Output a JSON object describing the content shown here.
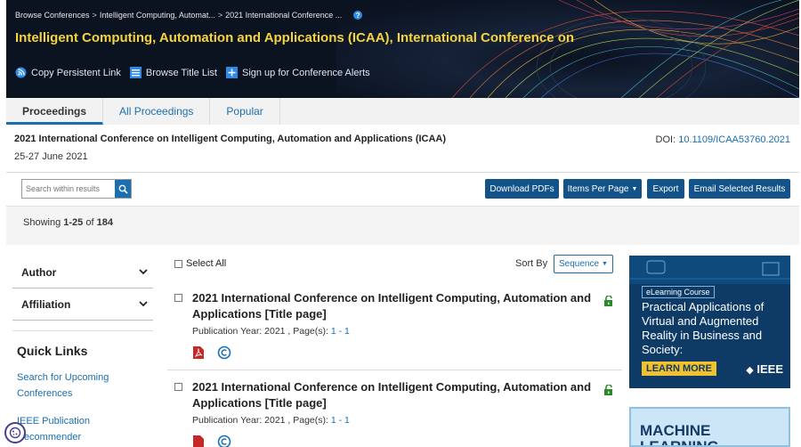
{
  "header": {
    "breadcrumbs": [
      "Browse Conferences",
      "Intelligent Computing, Automat...",
      "2021 International Conference ..."
    ],
    "help_icon": "?",
    "title": "Intelligent Computing, Automation and Applications (ICAA), International Conference on",
    "actions": [
      {
        "label": "Copy Persistent Link",
        "icon": "rss-icon"
      },
      {
        "label": "Browse Title List",
        "icon": "list-icon"
      },
      {
        "label": "Sign up for Conference Alerts",
        "icon": "plus-icon"
      }
    ]
  },
  "tabs": [
    "Proceedings",
    "All Proceedings",
    "Popular"
  ],
  "conference": {
    "name": "2021 International Conference on Intelligent Computing, Automation and Applications (ICAA)",
    "date": "25-27 June 2021",
    "doi_label": "DOI:",
    "doi_value": "10.1109/ICAA53760.2021"
  },
  "toolbar": {
    "search_placeholder": "Search within results",
    "buttons": [
      "Download PDFs",
      "Items Per Page",
      "Export",
      "Email Selected Results"
    ]
  },
  "showing": {
    "prefix": "Showing",
    "range": "1-25",
    "of": "of",
    "total": "184"
  },
  "sidebar": {
    "facets": [
      "Author",
      "Affiliation"
    ],
    "quick_links_title": "Quick Links",
    "links": [
      "Search for Upcoming Conferences",
      "IEEE Publication Recommender"
    ]
  },
  "results_header": {
    "select_all": "Select All",
    "sort_label": "Sort By",
    "sort_value": "Sequence"
  },
  "results": [
    {
      "title": "2021 International Conference on Intelligent Computing, Automation and Applications [Title page]",
      "meta_prefix": "Publication Year: 2021 , Page(s):",
      "pages": "1 - 1"
    },
    {
      "title": "2021 International Conference on Intelligent Computing, Automation and Applications [Title page]",
      "meta_prefix": "Publication Year: 2021 , Page(s):",
      "pages": "1 - 1"
    }
  ],
  "ads": {
    "ad1": {
      "badge": "eLearning Course",
      "text": "Practical Applications of Virtual and Augmented Reality in Business and Society:",
      "cta": "LEARN MORE",
      "brand": "IEEE"
    },
    "ad2": {
      "text": "MACHINE LEARNING"
    }
  },
  "colors": {
    "accent": "#13538a",
    "title_yellow": "#f5d43c",
    "link": "#1a6fb0"
  }
}
